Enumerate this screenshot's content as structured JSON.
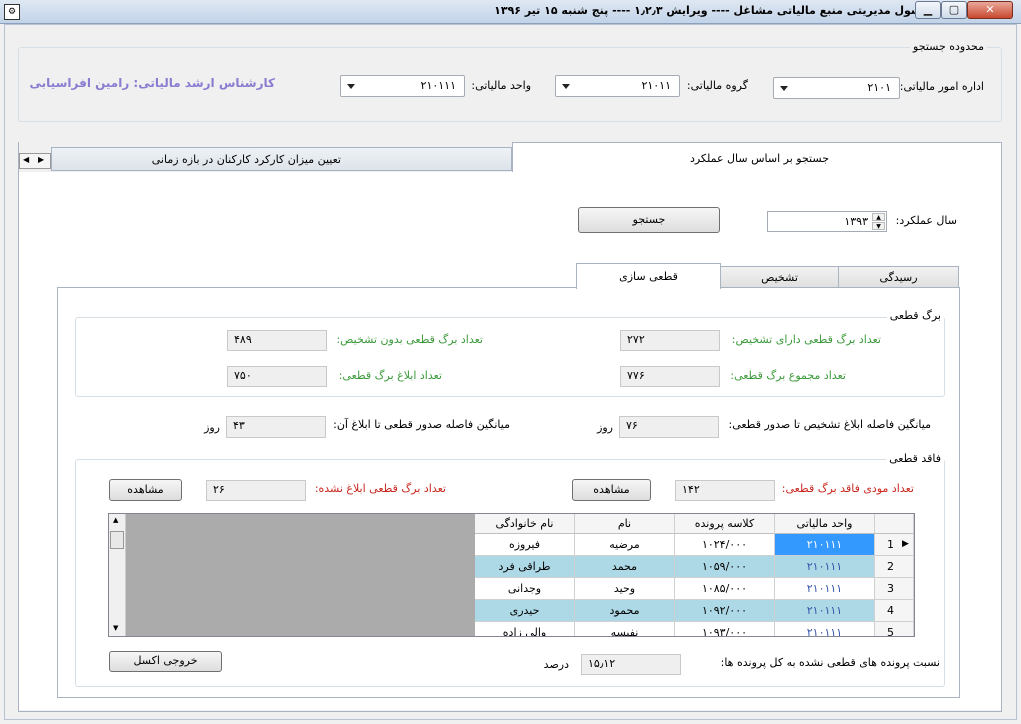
{
  "window": {
    "title": "کنسول مدیریتی منبع مالیاتی مشاغل    ----    ویرایش ۱٫۲٫۳    ----    پنج شنبه ۱۵ تیر ۱۳۹۶"
  },
  "search_scope": {
    "legend": "محدوده جستجو",
    "tax_office_label": "اداره امور مالیاتی:",
    "tax_office_value": "۲۱۰۱",
    "tax_group_label": "گروه مالیاتی:",
    "tax_group_value": "۲۱۰۱۱",
    "tax_unit_label": "واحد مالیاتی:",
    "tax_unit_value": "۲۱۰۱۱۱",
    "expert_label": "کارشناس ارشد مالیاتی: رامین افراسیابی"
  },
  "main_tabs": [
    {
      "label": "جستجو بر اساس سال عملکرد"
    },
    {
      "label": "تعیین میزان کارکرد کارکنان در بازه زمانی"
    }
  ],
  "year_search": {
    "label": "سال عملکرد:",
    "value": "۱۳۹۳",
    "button": "جستجو"
  },
  "sub_tabs": [
    {
      "label": "رسیدگی"
    },
    {
      "label": "تشخیص"
    },
    {
      "label": "قطعی سازی"
    }
  ],
  "final_sheet": {
    "legend": "برگ قطعی",
    "with_assessment_label": "تعداد برگ قطعی دارای تشخیص:",
    "with_assessment_value": "۲۷۲",
    "without_assessment_label": "تعداد برگ قطعی بدون تشخیص:",
    "without_assessment_value": "۴۸۹",
    "total_label": "تعداد مجموع برگ قطعی:",
    "total_value": "۷۷۶",
    "notified_label": "تعداد ابلاغ برگ قطعی:",
    "notified_value": "۷۵۰"
  },
  "averages": {
    "assess_to_final_label": "میانگین فاصله ابلاغ تشخیص تا صدور قطعی:",
    "assess_to_final_value": "۷۶",
    "final_to_notify_label": "میانگین فاصله صدور قطعی تا ابلاغ آن:",
    "final_to_notify_value": "۴۳",
    "unit": "روز"
  },
  "missing_final": {
    "legend": "فاقد قطعی",
    "taxpayers_label": "تعداد مودی فاقد برگ قطعی:",
    "taxpayers_value": "۱۴۲",
    "view_label": "مشاهده",
    "not_notified_label": "تعداد برگ قطعی ابلاغ نشده:",
    "not_notified_value": "۲۶",
    "view2_label": "مشاهده"
  },
  "grid": {
    "columns": [
      "واحد مالیاتی",
      "کلاسه پرونده",
      "نام",
      "نام خانوادگی"
    ],
    "rows": [
      {
        "num": "1",
        "unit": "۲۱۰۱۱۱",
        "file": "۱۰۲۴/۰۰۰",
        "first": "مرضیه",
        "last": "فیروزه"
      },
      {
        "num": "2",
        "unit": "۲۱۰۱۱۱",
        "file": "۱۰۵۹/۰۰۰",
        "first": "محمد",
        "last": "طراقی فرد"
      },
      {
        "num": "3",
        "unit": "۲۱۰۱۱۱",
        "file": "۱۰۸۵/۰۰۰",
        "first": "وحید",
        "last": "وجدانی"
      },
      {
        "num": "4",
        "unit": "۲۱۰۱۱۱",
        "file": "۱۰۹۲/۰۰۰",
        "first": "محمود",
        "last": "حیدری"
      },
      {
        "num": "5",
        "unit": "۲۱۰۱۱۱",
        "file": "۱۰۹۳/۰۰۰",
        "first": "نفیسه",
        "last": "والی زاده"
      }
    ]
  },
  "ratio": {
    "label": "نسبت پرونده های قطعی نشده به کل پرونده ها:",
    "value": "۱۵٫۱۲",
    "unit": "درصد"
  },
  "export_button": "خروجی اکسل",
  "colors": {
    "selected_cell": "#3399ff",
    "alt_row": "#add8e6",
    "green_label": "#3a9a3a",
    "red_label": "#c8261c",
    "expert_label": "#8b7bd1"
  }
}
